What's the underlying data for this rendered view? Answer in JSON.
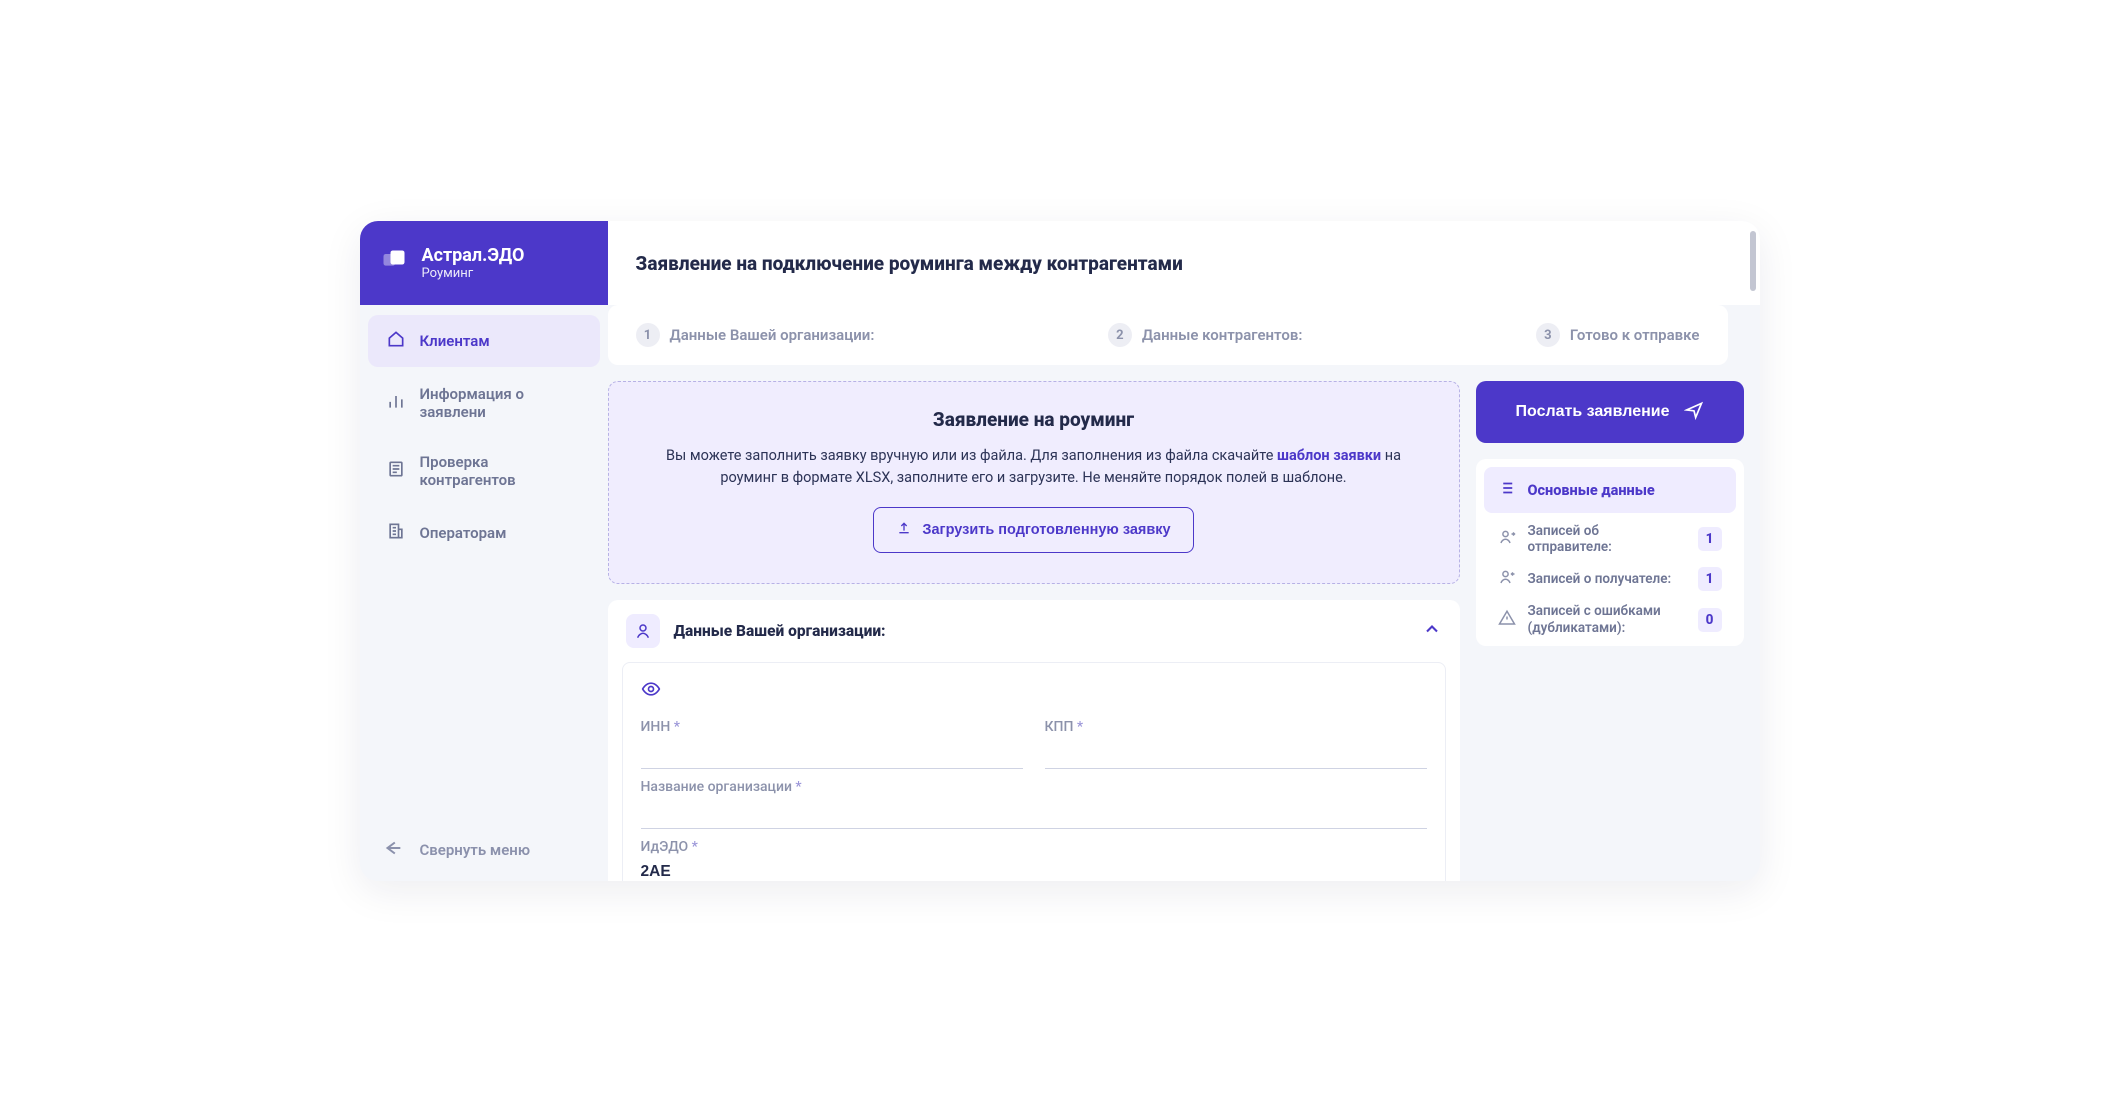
{
  "brand": {
    "title": "Астрал.ЭДО",
    "subtitle": "Роуминг"
  },
  "nav": {
    "items": [
      {
        "label": "Клиентам",
        "active": true
      },
      {
        "label": "Информация о заявлени",
        "active": false
      },
      {
        "label": "Проверка контрагентов",
        "active": false
      },
      {
        "label": "Операторам",
        "active": false
      }
    ],
    "collapse": "Свернуть меню"
  },
  "page": {
    "title": "Заявление на подключение роуминга между контрагентами"
  },
  "stepper": {
    "steps": [
      {
        "num": "1",
        "label": "Данные Вашей организации:"
      },
      {
        "num": "2",
        "label": "Данные контрагентов:"
      },
      {
        "num": "3",
        "label": "Готово к отправке"
      }
    ]
  },
  "roaming_block": {
    "title": "Заявление на роуминг",
    "line1a": "Вы можете заполнить заявку вручную или из файла. Для заполнения из файла скачайте ",
    "template_link": "шаблон заявки",
    "line1b": " на роуминг в формате XLSX, заполните его и загрузите. Не меняйте порядок полей в шаблоне.",
    "upload_btn": "Загрузить подготовленную заявку"
  },
  "org_section": {
    "title": "Данные Вашей организации:",
    "fields": {
      "inn": {
        "label": "ИНН",
        "value": ""
      },
      "kpp": {
        "label": "КПП",
        "value": ""
      },
      "org_name": {
        "label": "Название организации",
        "value": ""
      },
      "idedo": {
        "label": "ИдЭДО",
        "value": "2AE"
      }
    }
  },
  "right_panel": {
    "submit": "Послать заявление",
    "summary_title": "Основные данные",
    "rows": [
      {
        "label": "Записей об отправителе:",
        "count": "1"
      },
      {
        "label": "Записей о получателе:",
        "count": "1"
      },
      {
        "label": "Записей с ошибками (дубликатами):",
        "count": "0"
      }
    ]
  }
}
